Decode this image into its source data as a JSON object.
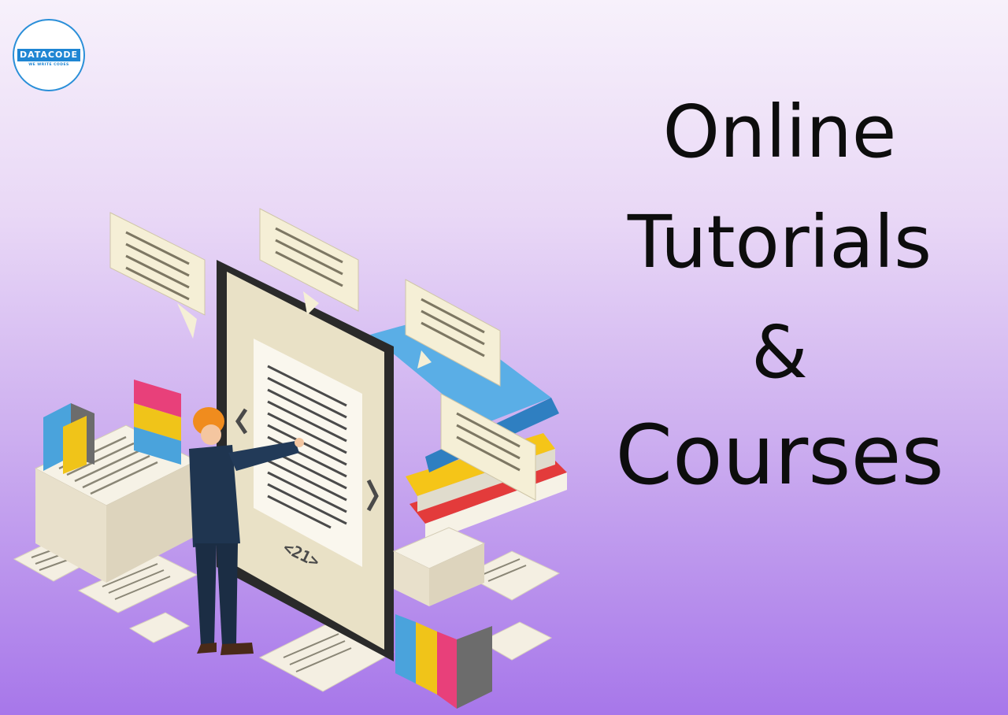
{
  "brand": {
    "name": "DATACODE",
    "tagline": "WE WRITE CODES"
  },
  "headline": {
    "line1": "Online",
    "line2": "Tutorials",
    "line3": "&",
    "line4": "Courses"
  },
  "illustration": {
    "page_number": "<21>"
  },
  "colors": {
    "accent": "#1f86d3",
    "bg_top": "#f7f1fb",
    "bg_bottom": "#a777ea"
  }
}
